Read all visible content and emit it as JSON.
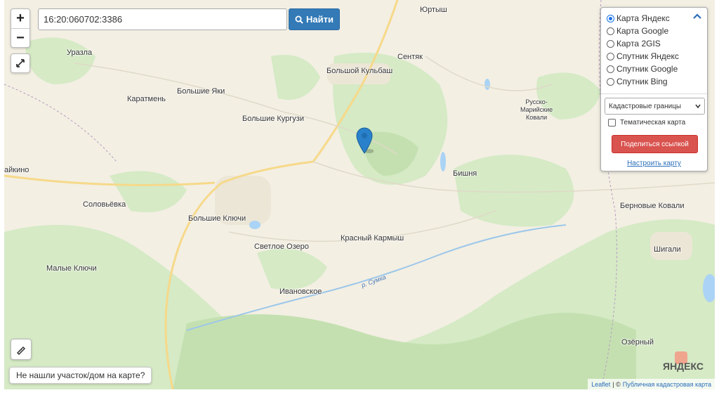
{
  "search": {
    "value": "16:20:060702:3386",
    "button_label": "Найти"
  },
  "zoom": {
    "in": "+",
    "out": "−"
  },
  "layers": {
    "options": [
      {
        "label": "Карта Яндекс",
        "selected": true
      },
      {
        "label": "Карта Google",
        "selected": false
      },
      {
        "label": "Карта 2GIS",
        "selected": false
      },
      {
        "label": "Спутник Яндекс",
        "selected": false
      },
      {
        "label": "Спутник Google",
        "selected": false
      },
      {
        "label": "Спутник Bing",
        "selected": false
      }
    ],
    "overlay_select": "Кадастровые границы",
    "thematic_label": "Тематическая карта",
    "share_label": "Поделиться ссылкой",
    "configure_label": "Настроить карту"
  },
  "not_found_label": "Не нашли участок/дом на карте?",
  "attribution": {
    "leaflet": "Leaflet",
    "sep": "| ©",
    "source": "Публичная кадастровая карта"
  },
  "watermark": "ЯНДЕКС",
  "places": [
    {
      "id": "yurtysh",
      "name": "Юртыш"
    },
    {
      "id": "urazla",
      "name": "Уразла"
    },
    {
      "id": "sentyak",
      "name": "Сентяк"
    },
    {
      "id": "bolshoy-kulbash",
      "name": "Большой Кульбаш"
    },
    {
      "id": "karatmen",
      "name": "Каратмень"
    },
    {
      "id": "bolshie-yaki",
      "name": "Большие Яки"
    },
    {
      "id": "russko-mariyskie",
      "name": "Русско-\nМарийские\nКовали"
    },
    {
      "id": "bolshie-kurguzi",
      "name": "Большие Кургузи"
    },
    {
      "id": "aykino",
      "name": "айкино"
    },
    {
      "id": "bishnya",
      "name": "Бишня"
    },
    {
      "id": "solovyovka",
      "name": "Соловьёвка"
    },
    {
      "id": "bolshie-klyuchi",
      "name": "Большие Ключи"
    },
    {
      "id": "bernovye-kovali",
      "name": "Берновые Ковали"
    },
    {
      "id": "krasny-karmysh",
      "name": "Красный Кармыш"
    },
    {
      "id": "svetloe-ozero",
      "name": "Светлое Озеро"
    },
    {
      "id": "shigali",
      "name": "Шигали"
    },
    {
      "id": "malye-klyuchi",
      "name": "Малые Ключи"
    },
    {
      "id": "ivanovskoe",
      "name": "Ивановское"
    },
    {
      "id": "ozyorny",
      "name": "Озёрный"
    }
  ],
  "river": "р. Сумка"
}
